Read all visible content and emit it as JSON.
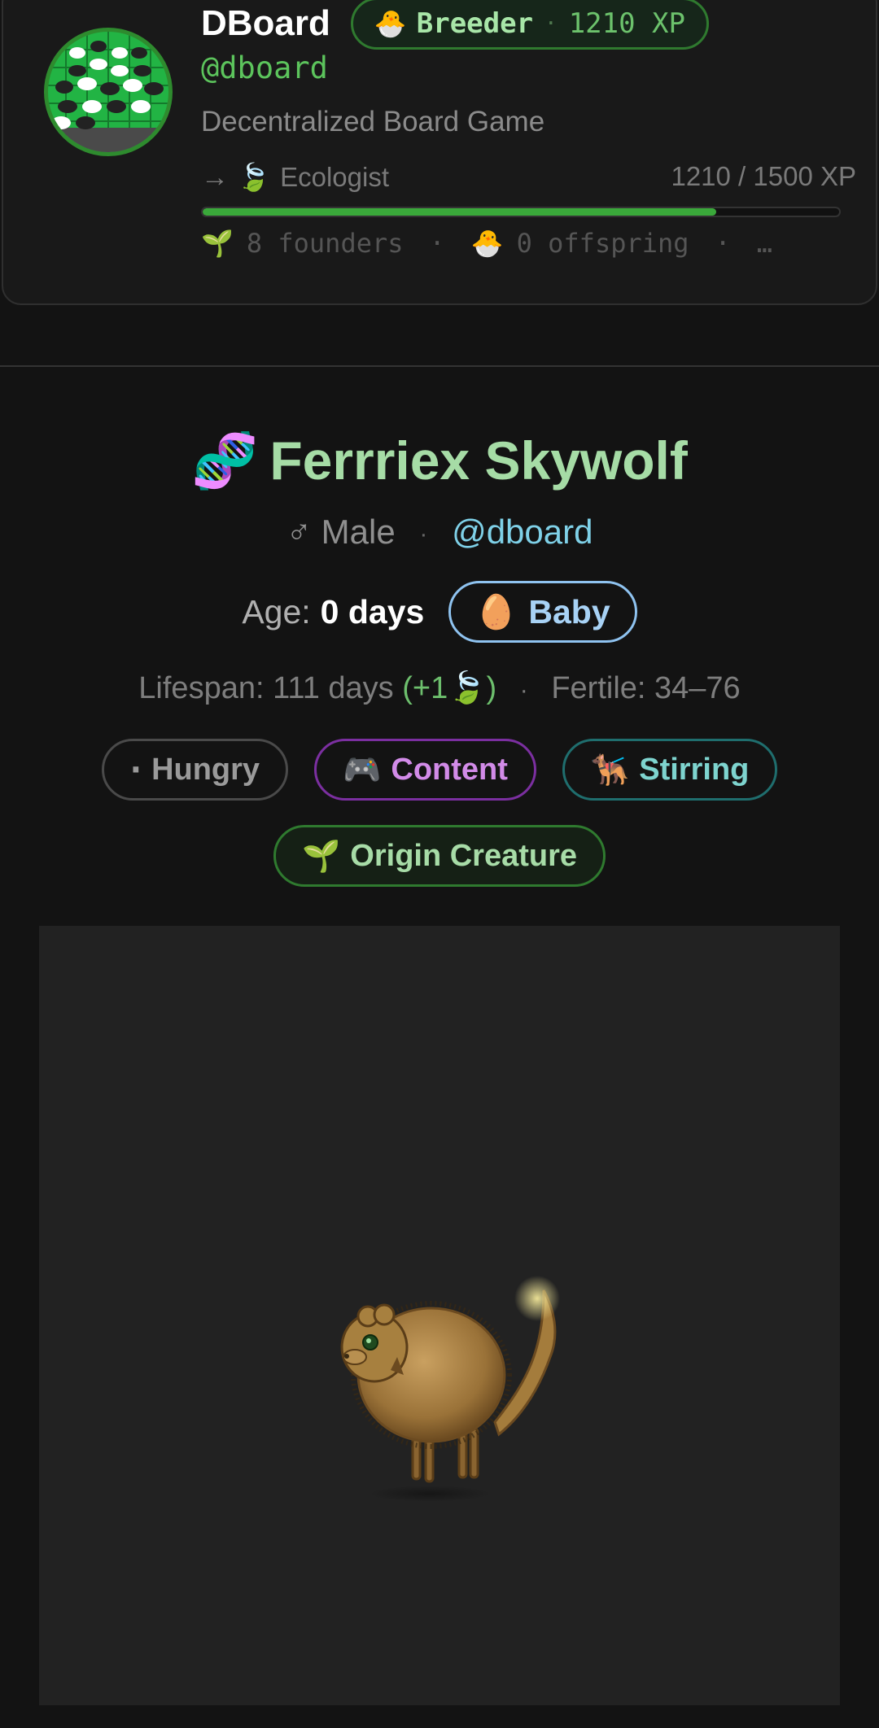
{
  "profile": {
    "display_name": "DBoard",
    "rank": {
      "emoji": "🐣",
      "name": "Breeder",
      "separator": "·",
      "xp": "1210 XP"
    },
    "handle": "@dboard",
    "bio": "Decentralized Board Game",
    "next_rank": {
      "arrow": "→",
      "emoji": "🍃",
      "name": "Ecologist"
    },
    "xp_progress_text": "1210 / 1500 XP",
    "xp_current": 1210,
    "xp_target": 1500,
    "stats": {
      "founders_emoji": "🌱",
      "founders": "8 founders",
      "offspring_emoji": "🐣",
      "offspring": "0 offspring",
      "separator": "·",
      "more": "…"
    }
  },
  "creature": {
    "title_emoji": "🧬",
    "name": "Ferrriex Skywolf",
    "gender_symbol": "♂",
    "gender": "Male",
    "separator": "·",
    "owner": "@dboard",
    "age_label": "Age:",
    "age_value": "0 days",
    "stage": {
      "emoji": "🥚",
      "label": "Baby"
    },
    "lifespan": "Lifespan: 111 days",
    "lifespan_bonus": "(+1🍃)",
    "fertile": "Fertile: 34–76",
    "statuses": [
      {
        "emoji": "·",
        "label": "Hungry"
      },
      {
        "emoji": "🎮",
        "label": "Content"
      },
      {
        "emoji": "🐕‍🦺",
        "label": "Stirring"
      }
    ],
    "origin": {
      "emoji": "🌱",
      "label": "Origin Creature"
    }
  },
  "colors": {
    "accent_green": "#5cc45c",
    "title_green": "#a6dca6",
    "owner_cyan": "#7fd1e8",
    "stage_blue": "#a8d2f5",
    "content_purple": "#d28be8",
    "stirring_teal": "#7ed4cf",
    "background": "#131313"
  }
}
